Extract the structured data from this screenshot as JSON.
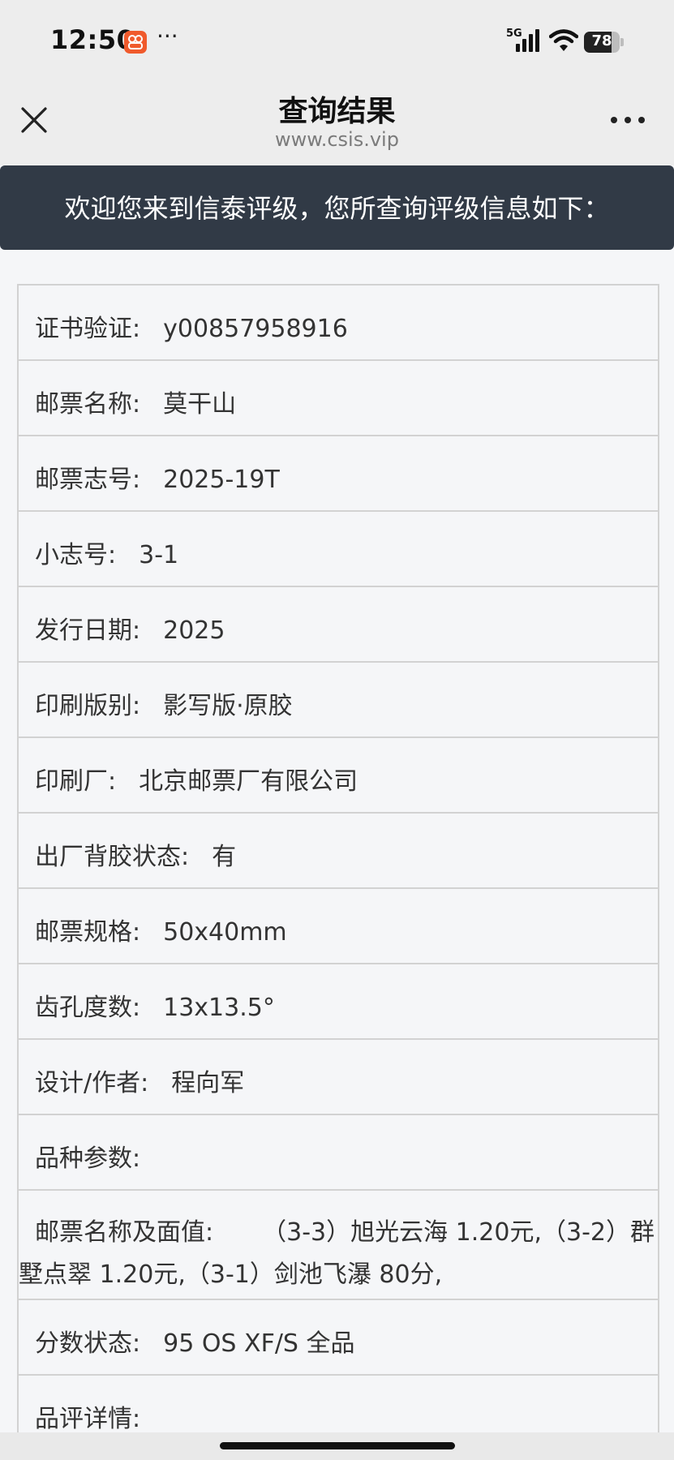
{
  "status_bar": {
    "time": "12:50",
    "more": "···",
    "network": "5G",
    "battery_level": "78",
    "battery_fraction": 0.78
  },
  "nav": {
    "title": "查询结果",
    "subtitle": "www.csis.vip",
    "close_icon": "close-icon",
    "more_icon": "more-icon"
  },
  "banner": {
    "text": "欢迎您来到信泰评级，您所查询评级信息如下："
  },
  "rows": [
    {
      "label": "证书验证:",
      "value": "y00857958916"
    },
    {
      "label": "邮票名称:",
      "value": "莫干山"
    },
    {
      "label": "邮票志号:",
      "value": "2025-19T"
    },
    {
      "label": "小志号:",
      "value": "3-1"
    },
    {
      "label": "发行日期:",
      "value": "2025"
    },
    {
      "label": "印刷版别:",
      "value": "影写版·原胶"
    },
    {
      "label": "印刷厂:",
      "value": "北京邮票厂有限公司"
    },
    {
      "label": "出厂背胶状态:",
      "value": "有"
    },
    {
      "label": "邮票规格:",
      "value": "50x40mm"
    },
    {
      "label": "齿孔度数:",
      "value": "13x13.5°"
    },
    {
      "label": "设计/作者:",
      "value": "程向军"
    },
    {
      "label": "品种参数:",
      "value": ""
    },
    {
      "label": "邮票名称及面值:",
      "value": "（3-3）旭光云海 1.20元,（3-2）群墅点翠 1.20元,（3-1）剑池飞瀑 80分,"
    },
    {
      "label": "分数状态:",
      "value": "95 OS  XF/S  全品"
    },
    {
      "label": "品评详情:",
      "value": ""
    }
  ]
}
